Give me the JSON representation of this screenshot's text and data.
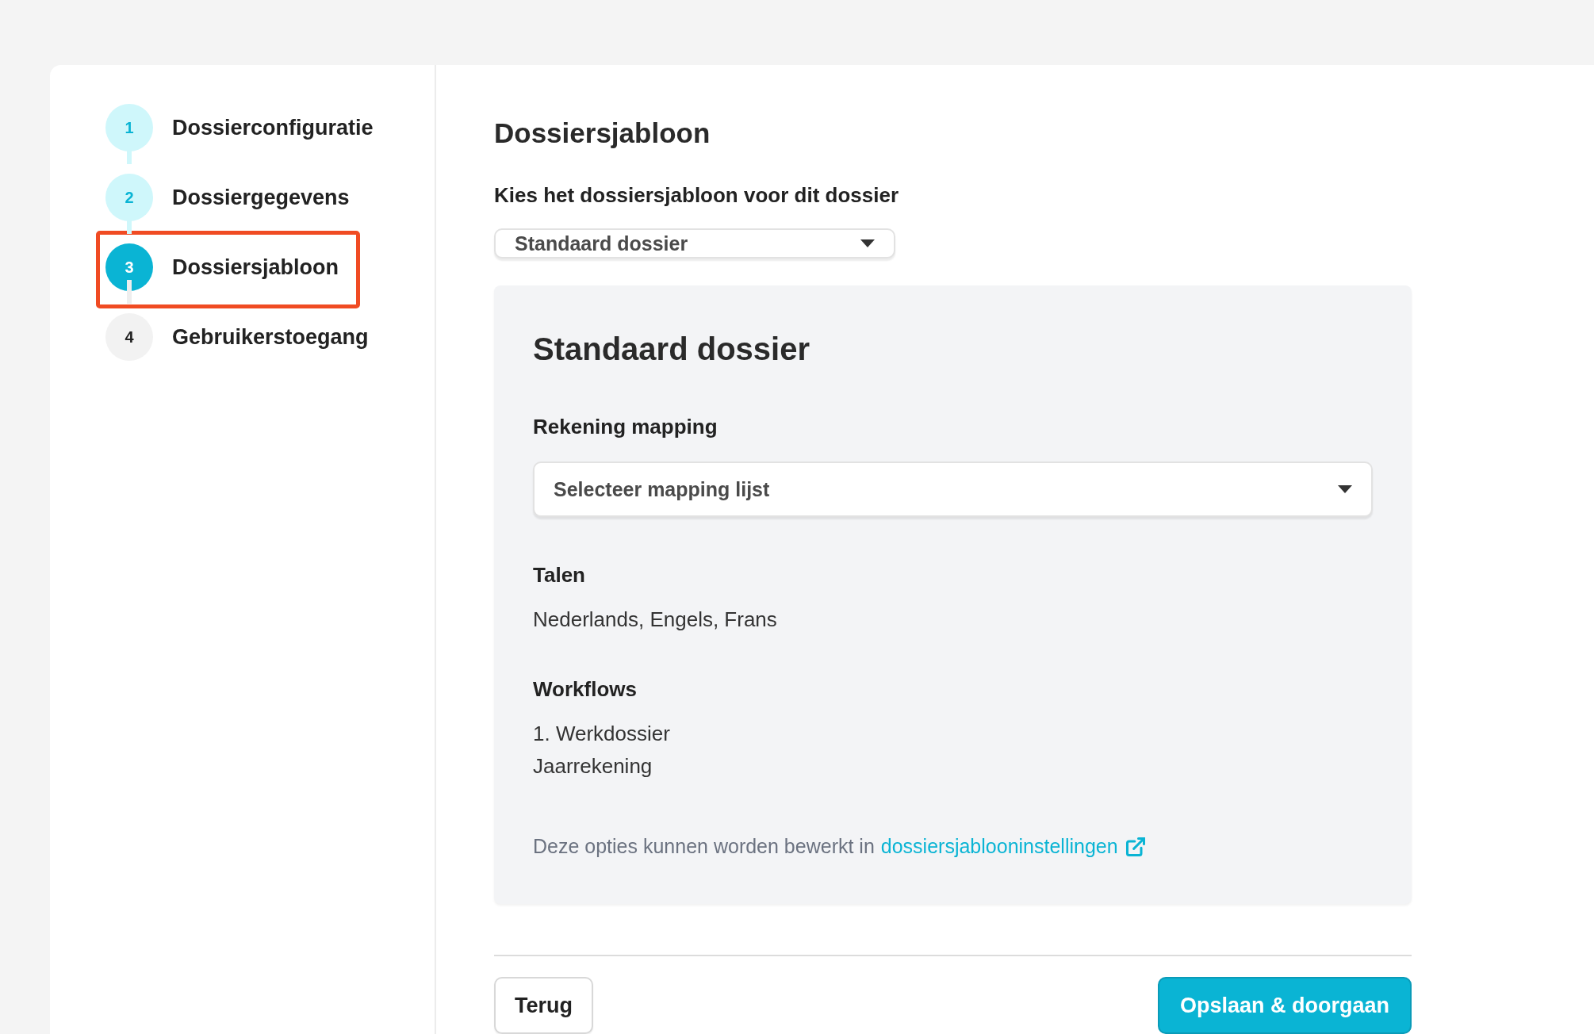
{
  "steps": [
    {
      "number": "1",
      "label": "Dossierconfiguratie",
      "kind": "done",
      "highlighted": false
    },
    {
      "number": "2",
      "label": "Dossiergegevens",
      "kind": "done",
      "highlighted": false
    },
    {
      "number": "3",
      "label": "Dossiersjabloon",
      "kind": "active",
      "highlighted": true
    },
    {
      "number": "4",
      "label": "Gebruikerstoegang",
      "kind": "pending",
      "highlighted": false
    }
  ],
  "main": {
    "title": "Dossiersjabloon",
    "template_label": "Kies het dossiersjabloon voor dit dossier",
    "template_select": {
      "value": "Standaard dossier"
    },
    "panel": {
      "title": "Standaard dossier",
      "mapping_label": "Rekening mapping",
      "mapping_select": {
        "placeholder": "Selecteer mapping lijst"
      },
      "languages_label": "Talen",
      "languages": "Nederlands, Engels, Frans",
      "workflows_label": "Workflows",
      "workflows": [
        "1. Werkdossier",
        "Jaarrekening"
      ],
      "note": "Deze opties kunnen worden bewerkt in",
      "note_link": "dossiersjablooninstellingen"
    }
  },
  "buttons": {
    "back": "Terug",
    "save": "Opslaan & doorgaan"
  }
}
